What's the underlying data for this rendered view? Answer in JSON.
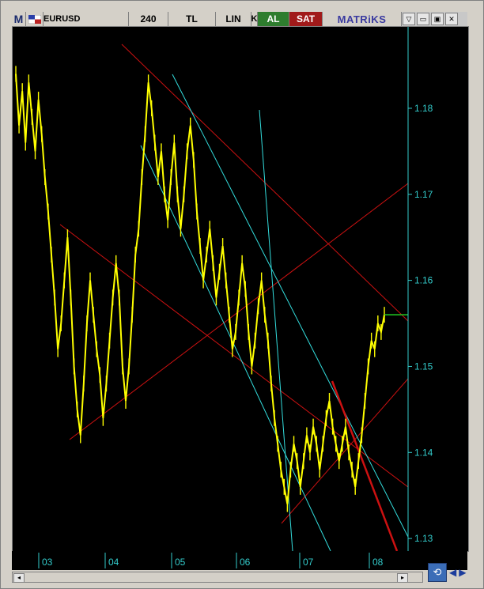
{
  "toolbar": {
    "logo_letter": "M",
    "flag_icon": "flag-icon",
    "symbol": "EURUSD",
    "period": "240",
    "currency": "TL",
    "scale": "LIN",
    "k_label": "K",
    "buy_label": "AL",
    "sell_label": "SAT",
    "brand": "MATRiKS",
    "window_buttons": [
      "▽",
      "▭",
      "▣",
      "✕"
    ]
  },
  "colors": {
    "price_line": "#ffff00",
    "trend_red": "#cc1111",
    "trend_cyan": "#33dddd",
    "axis": "#33cccc",
    "last_price_marker": "#22cc22"
  },
  "chart_data": {
    "type": "line",
    "title": "EURUSD",
    "y_ticks": [
      "1.18",
      "1.17",
      "1.16",
      "1.15",
      "1.14",
      "1.13"
    ],
    "x_ticks": [
      "03",
      "04",
      "05",
      "06",
      "07",
      "08"
    ],
    "ylim": [
      1.129,
      1.189
    ],
    "series": [
      {
        "values": [
          1.184,
          1.178,
          1.182,
          1.176,
          1.183,
          1.179,
          1.175,
          1.181,
          1.177,
          1.172,
          1.168,
          1.163,
          1.158,
          1.152,
          1.155,
          1.16,
          1.165,
          1.158,
          1.15,
          1.145,
          1.142,
          1.148,
          1.155,
          1.16,
          1.156,
          1.152,
          1.149,
          1.144,
          1.148,
          1.153,
          1.158,
          1.162,
          1.158,
          1.15,
          1.146,
          1.15,
          1.156,
          1.163,
          1.166,
          1.172,
          1.177,
          1.183,
          1.18,
          1.176,
          1.172,
          1.175,
          1.17,
          1.167,
          1.172,
          1.176,
          1.17,
          1.166,
          1.17,
          1.175,
          1.178,
          1.174,
          1.168,
          1.164,
          1.16,
          1.163,
          1.166,
          1.162,
          1.158,
          1.161,
          1.164,
          1.16,
          1.156,
          1.152,
          1.154,
          1.158,
          1.162,
          1.159,
          1.154,
          1.15,
          1.153,
          1.157,
          1.16,
          1.156,
          1.153,
          1.148,
          1.144,
          1.141,
          1.138,
          1.136,
          1.134,
          1.138,
          1.141,
          1.139,
          1.136,
          1.139,
          1.142,
          1.14,
          1.143,
          1.141,
          1.138,
          1.141,
          1.144,
          1.146,
          1.143,
          1.141,
          1.139,
          1.141,
          1.143,
          1.14,
          1.138,
          1.136,
          1.139,
          1.142,
          1.146,
          1.15,
          1.153,
          1.152,
          1.155,
          1.154,
          1.156
        ]
      }
    ],
    "last_price": 1.156
  },
  "scrollbar": {
    "left_arrow": "◂",
    "right_arrow": "▸"
  },
  "nav": {
    "refresh_icon": "refresh-icon",
    "prev": "◀",
    "next": "▶"
  }
}
